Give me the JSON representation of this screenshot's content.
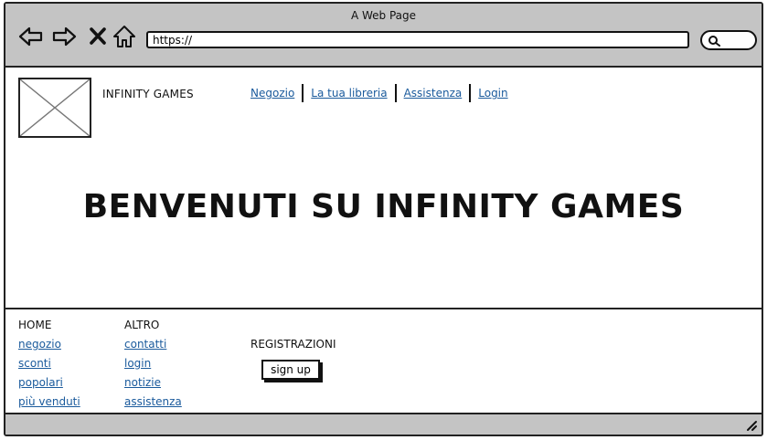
{
  "window": {
    "title": "A Web Page"
  },
  "address_bar": {
    "url": "https://"
  },
  "header": {
    "brand": "INFINITY GAMES",
    "nav": [
      {
        "label": "Negozio"
      },
      {
        "label": "La tua libreria"
      },
      {
        "label": "Assistenza"
      },
      {
        "label": "Login"
      }
    ]
  },
  "hero": {
    "title": "BENVENUTI SU INFINITY GAMES"
  },
  "footer": {
    "home": {
      "heading": "HOME",
      "links": [
        "negozio",
        "sconti",
        "popolari",
        "più venduti"
      ]
    },
    "altro": {
      "heading": "ALTRO",
      "links": [
        "contatti",
        "login",
        "notizie",
        "assistenza"
      ]
    },
    "registrazioni": {
      "heading": "REGISTRAZIONI",
      "button": "sign up"
    }
  },
  "colors": {
    "chrome": "#c4c4c4",
    "link": "#1a5a9c",
    "outline": "#222222"
  }
}
